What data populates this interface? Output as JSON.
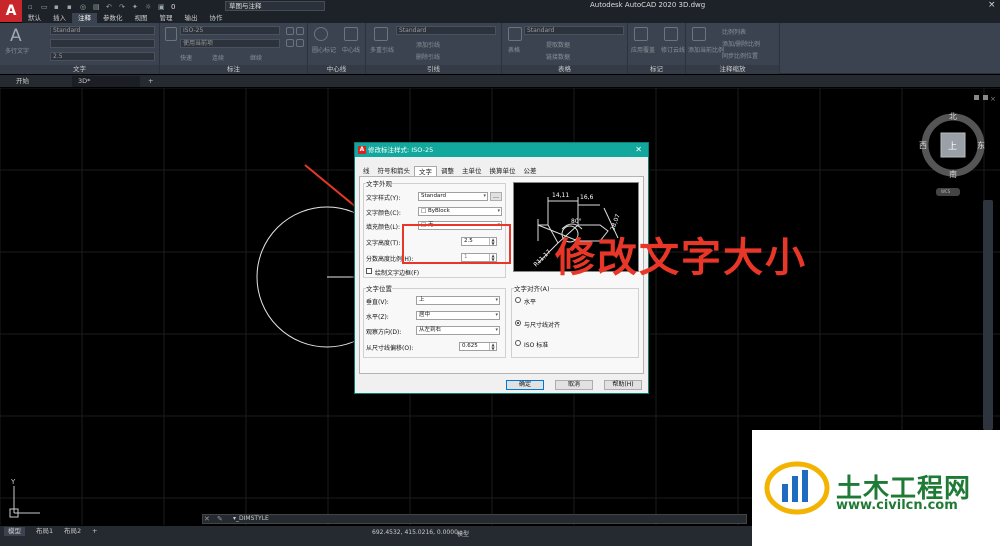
{
  "app": {
    "logo": "A",
    "title": "Autodesk AutoCAD 2020    3D.dwg",
    "workspace": "草图与注释",
    "layer": "0",
    "close": "×"
  },
  "menu": [
    "默认",
    "插入",
    "注释",
    "参数化",
    "视图",
    "管理",
    "输出",
    "协作"
  ],
  "menu_active": "注释",
  "ribbon": {
    "text_panel": {
      "label": "文字",
      "big_button": "多行文字",
      "style_value": "Standard",
      "height_value": "2.5"
    },
    "dim_panel": {
      "label": "标注",
      "style_value": "ISO-25",
      "use_current": "使用当前项",
      "options": [
        "快速",
        "连续",
        "继续"
      ]
    },
    "center_panel": {
      "label": "中心线",
      "items": [
        "圆心标记",
        "中心线"
      ]
    },
    "leader_panel": {
      "label": "引线",
      "style_value": "Standard",
      "items": [
        "多重引线",
        "添加引线",
        "删除引线"
      ]
    },
    "table_panel": {
      "label": "表格",
      "style_value": "Standard",
      "items": [
        "表格",
        "提取数据",
        "链接数据"
      ]
    },
    "markup_panel": {
      "label": "标记",
      "items": [
        "应用覆盖",
        "修订云线"
      ]
    },
    "scale_panel": {
      "label": "注释缩放",
      "items": [
        "添加当前比例",
        "比例列表",
        "添加/删除比例",
        "同步比例位置"
      ]
    }
  },
  "file_tabs": [
    "开始",
    "3D*"
  ],
  "dialog": {
    "title": "修改标注样式: ISO-25",
    "tabs": [
      "线",
      "符号和箭头",
      "文字",
      "调整",
      "主单位",
      "换算单位",
      "公差"
    ],
    "active_tab": "文字",
    "appearance": {
      "title": "文字外观",
      "style_label": "文字样式(Y):",
      "style_value": "Standard",
      "color_label": "文字颜色(C):",
      "color_value": "ByBlock",
      "fill_label": "填充颜色(L):",
      "fill_value": "无",
      "height_label": "文字高度(T):",
      "height_value": "2.5",
      "fraction_label": "分数高度比例(H):",
      "fraction_value": "1",
      "frame_label": "绘制文字边框(F)"
    },
    "placement": {
      "title": "文字位置",
      "vertical_label": "垂直(V):",
      "vertical_value": "上",
      "horizontal_label": "水平(Z):",
      "horizontal_value": "居中",
      "view_label": "观察方向(D):",
      "view_value": "从左到右",
      "offset_label": "从尺寸线偏移(O):",
      "offset_value": "0.625"
    },
    "alignment": {
      "title": "文字对齐(A)",
      "options": [
        "水平",
        "与尺寸线对齐",
        "ISO 标准"
      ],
      "selected": 1
    },
    "preview": {
      "labels": [
        "14,11",
        "16,6",
        "28,07",
        "80°",
        "R11,17"
      ]
    },
    "buttons": {
      "ok": "确定",
      "cancel": "取消",
      "help": "帮助(H)"
    }
  },
  "annotation": {
    "text": "修改文字大小"
  },
  "viewcube": {
    "north": "北",
    "south": "南",
    "east": "东",
    "west": "西",
    "face": "上",
    "wcs": "WCS"
  },
  "command_line": {
    "prompt": "▾_DIMSTYLE"
  },
  "status": {
    "layout_tabs": [
      "模型",
      "布局1",
      "布局2"
    ],
    "coords": "692.4532, 415.0216, 0.0000",
    "model": "模型"
  },
  "watermark": {
    "title": "土木工程网",
    "url": "www.civilcn.com"
  },
  "colors": {
    "accent": "#12a89d",
    "annotation": "#e83728",
    "watermark": "#1f7a36"
  }
}
